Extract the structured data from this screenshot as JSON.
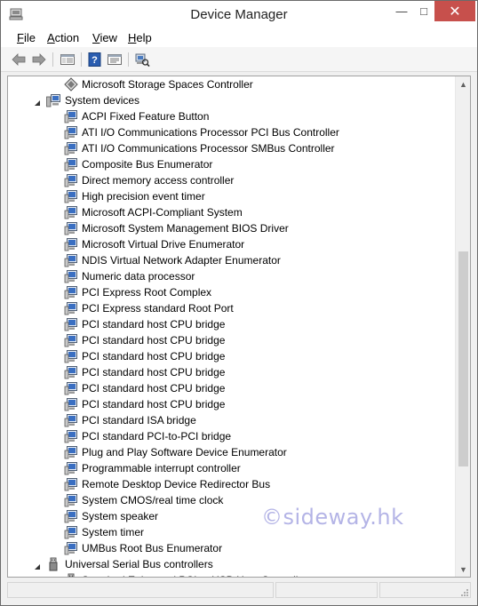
{
  "window": {
    "title": "Device Manager",
    "minimize_label": "—",
    "maximize_label": "□",
    "close_label": "✕"
  },
  "menu": {
    "file": "File",
    "action": "Action",
    "view": "View",
    "help": "Help"
  },
  "toolbar": {
    "items": [
      "back-icon",
      "forward-icon",
      "show-hide-tree-icon",
      "help-icon",
      "properties-icon",
      "scan-hardware-icon"
    ]
  },
  "tree": {
    "rows": [
      {
        "label": "Microsoft Storage Spaces Controller",
        "level": 2,
        "icon": "storage-controller-icon"
      },
      {
        "label": "System devices",
        "level": 1,
        "icon": "system-devices-category-icon",
        "expanded": true
      },
      {
        "label": "ACPI Fixed Feature Button",
        "level": 2,
        "icon": "system-device-icon"
      },
      {
        "label": "ATI I/O Communications Processor PCI Bus Controller",
        "level": 2,
        "icon": "system-device-icon"
      },
      {
        "label": "ATI I/O Communications Processor SMBus Controller",
        "level": 2,
        "icon": "system-device-icon"
      },
      {
        "label": "Composite Bus Enumerator",
        "level": 2,
        "icon": "system-device-icon"
      },
      {
        "label": "Direct memory access controller",
        "level": 2,
        "icon": "system-device-icon"
      },
      {
        "label": "High precision event timer",
        "level": 2,
        "icon": "system-device-icon"
      },
      {
        "label": "Microsoft ACPI-Compliant System",
        "level": 2,
        "icon": "system-device-icon"
      },
      {
        "label": "Microsoft System Management BIOS Driver",
        "level": 2,
        "icon": "system-device-icon"
      },
      {
        "label": "Microsoft Virtual Drive Enumerator",
        "level": 2,
        "icon": "system-device-icon"
      },
      {
        "label": "NDIS Virtual Network Adapter Enumerator",
        "level": 2,
        "icon": "system-device-icon"
      },
      {
        "label": "Numeric data processor",
        "level": 2,
        "icon": "system-device-icon"
      },
      {
        "label": "PCI Express Root Complex",
        "level": 2,
        "icon": "system-device-icon"
      },
      {
        "label": "PCI Express standard Root Port",
        "level": 2,
        "icon": "system-device-icon"
      },
      {
        "label": "PCI standard host CPU bridge",
        "level": 2,
        "icon": "system-device-icon"
      },
      {
        "label": "PCI standard host CPU bridge",
        "level": 2,
        "icon": "system-device-icon"
      },
      {
        "label": "PCI standard host CPU bridge",
        "level": 2,
        "icon": "system-device-icon"
      },
      {
        "label": "PCI standard host CPU bridge",
        "level": 2,
        "icon": "system-device-icon"
      },
      {
        "label": "PCI standard host CPU bridge",
        "level": 2,
        "icon": "system-device-icon"
      },
      {
        "label": "PCI standard host CPU bridge",
        "level": 2,
        "icon": "system-device-icon"
      },
      {
        "label": "PCI standard ISA bridge",
        "level": 2,
        "icon": "system-device-icon"
      },
      {
        "label": "PCI standard PCI-to-PCI bridge",
        "level": 2,
        "icon": "system-device-icon"
      },
      {
        "label": "Plug and Play Software Device Enumerator",
        "level": 2,
        "icon": "system-device-icon"
      },
      {
        "label": "Programmable interrupt controller",
        "level": 2,
        "icon": "system-device-icon"
      },
      {
        "label": "Remote Desktop Device Redirector Bus",
        "level": 2,
        "icon": "system-device-icon"
      },
      {
        "label": "System CMOS/real time clock",
        "level": 2,
        "icon": "system-device-icon"
      },
      {
        "label": "System speaker",
        "level": 2,
        "icon": "system-device-icon"
      },
      {
        "label": "System timer",
        "level": 2,
        "icon": "system-device-icon"
      },
      {
        "label": "UMBus Root Bus Enumerator",
        "level": 2,
        "icon": "system-device-icon"
      },
      {
        "label": "Universal Serial Bus controllers",
        "level": 1,
        "icon": "usb-category-icon",
        "expanded": true
      },
      {
        "label": "Standard Enhanced PCI to USB Host Controller",
        "level": 2,
        "icon": "usb-controller-icon"
      }
    ]
  },
  "scrollbar": {
    "position": 0.45
  },
  "watermark": {
    "text": "©sideway.hk"
  }
}
